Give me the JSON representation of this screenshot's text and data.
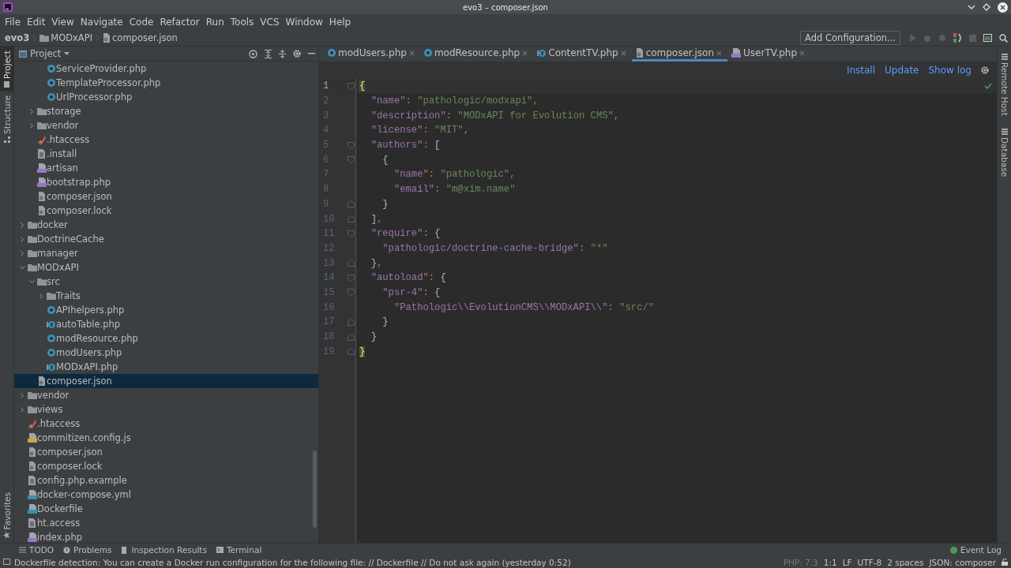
{
  "window": {
    "title": "evo3 – composer.json"
  },
  "menu": [
    "File",
    "Edit",
    "View",
    "Navigate",
    "Code",
    "Refactor",
    "Run",
    "Tools",
    "VCS",
    "Window",
    "Help"
  ],
  "breadcrumb": [
    {
      "label": "evo3",
      "kind": "project"
    },
    {
      "label": "MODxAPI",
      "kind": "folder"
    },
    {
      "label": "composer.json",
      "kind": "composer"
    }
  ],
  "toolbar": {
    "run_configuration": "Add Configuration..."
  },
  "left_stripe": [
    {
      "label": "Project",
      "selected": true
    },
    {
      "label": "Structure",
      "selected": false
    }
  ],
  "favorites": "Favorites",
  "right_stripe": [
    "Remote Host",
    "Database"
  ],
  "project": {
    "title": "Project",
    "tree": [
      {
        "children": [
          {
            "children": [
              {
                "label": "ServiceProvider.php",
                "kind": "class",
                "selected": false
              },
              {
                "label": "TemplateProcessor.php",
                "kind": "class",
                "selected": false
              },
              {
                "label": "UrlProcessor.php",
                "kind": "class",
                "selected": false
              }
            ]
          },
          {
            "label": "storage",
            "kind": "folder",
            "expanded": false,
            "selected": false
          },
          {
            "label": "vendor",
            "kind": "folder",
            "expanded": false,
            "selected": false
          },
          {
            "label": ".htaccess",
            "kind": "htaccess",
            "selected": false
          },
          {
            "label": ".install",
            "kind": "text",
            "selected": false
          },
          {
            "label": "artisan",
            "kind": "php",
            "selected": false
          },
          {
            "label": "bootstrap.php",
            "kind": "php",
            "selected": false
          },
          {
            "label": "composer.json",
            "kind": "composer",
            "selected": false
          },
          {
            "label": "composer.lock",
            "kind": "composer",
            "selected": false
          }
        ]
      },
      {
        "label": "docker",
        "kind": "folder",
        "expanded": false,
        "selected": false
      },
      {
        "label": "DoctrineCache",
        "kind": "folder",
        "expanded": false,
        "selected": false
      },
      {
        "label": "manager",
        "kind": "folder",
        "expanded": false,
        "selected": false
      },
      {
        "label": "MODxAPI",
        "kind": "folder",
        "expanded": true,
        "selected": false,
        "children": [
          {
            "label": "src",
            "kind": "folder",
            "expanded": true,
            "selected": false,
            "children": [
              {
                "label": "Traits",
                "kind": "folder",
                "expanded": false,
                "selected": false
              },
              {
                "label": "APIhelpers.php",
                "kind": "class",
                "selected": false
              },
              {
                "label": "autoTable.php",
                "kind": "interface",
                "selected": false
              },
              {
                "label": "modResource.php",
                "kind": "class",
                "selected": false
              },
              {
                "label": "modUsers.php",
                "kind": "class",
                "selected": false
              },
              {
                "label": "MODxAPI.php",
                "kind": "interface",
                "selected": false
              }
            ]
          },
          {
            "label": "composer.json",
            "kind": "composer",
            "selected": true
          }
        ]
      },
      {
        "label": "vendor",
        "kind": "folder",
        "expanded": false,
        "selected": false
      },
      {
        "label": "views",
        "kind": "folder",
        "expanded": false,
        "selected": false
      },
      {
        "label": ".htaccess",
        "kind": "htaccess",
        "selected": false
      },
      {
        "label": "commitizen.config.js",
        "kind": "js",
        "selected": false
      },
      {
        "label": "composer.json",
        "kind": "composer",
        "selected": false
      },
      {
        "label": "composer.lock",
        "kind": "composer",
        "selected": false
      },
      {
        "label": "config.php.example",
        "kind": "text",
        "selected": false
      },
      {
        "label": "docker-compose.yml",
        "kind": "yml",
        "selected": false
      },
      {
        "label": "Dockerfile",
        "kind": "yml",
        "selected": false
      },
      {
        "label": "ht.access",
        "kind": "text",
        "selected": false
      },
      {
        "label": "index.php",
        "kind": "php",
        "selected": false
      }
    ]
  },
  "tabs": [
    {
      "label": "modUsers.php",
      "kind": "class",
      "selected": false
    },
    {
      "label": "modResource.php",
      "kind": "class",
      "selected": false
    },
    {
      "label": "ContentTV.php",
      "kind": "interface",
      "selected": false
    },
    {
      "label": "composer.json",
      "kind": "composer",
      "selected": true
    },
    {
      "label": "UserTV.php",
      "kind": "php",
      "selected": false
    }
  ],
  "editor_actions": [
    "Install",
    "Update",
    "Show log"
  ],
  "code": [
    {
      "number": "1",
      "current": true,
      "kind": "open",
      "tokens": [
        {
          "kind": "match",
          "text": "{"
        }
      ]
    },
    {
      "number": "2",
      "current": false,
      "kind": "plain",
      "tokens": [
        {
          "kind": "key",
          "text": "  \"name\""
        },
        {
          "kind": "punct",
          "text": ": "
        },
        {
          "kind": "str",
          "text": "\"pathologic/modxapi\""
        },
        {
          "kind": "punct",
          "text": ","
        }
      ]
    },
    {
      "number": "3",
      "current": false,
      "kind": "plain",
      "tokens": [
        {
          "kind": "key",
          "text": "  \"description\""
        },
        {
          "kind": "punct",
          "text": ": "
        },
        {
          "kind": "str",
          "text": "\"MODxAPI for Evolution CMS\""
        },
        {
          "kind": "punct",
          "text": ","
        }
      ]
    },
    {
      "number": "4",
      "current": false,
      "kind": "plain",
      "tokens": [
        {
          "kind": "key",
          "text": "  \"license\""
        },
        {
          "kind": "punct",
          "text": ": "
        },
        {
          "kind": "str",
          "text": "\"MIT\""
        },
        {
          "kind": "punct",
          "text": ","
        }
      ]
    },
    {
      "number": "5",
      "current": false,
      "kind": "open",
      "tokens": [
        {
          "kind": "key",
          "text": "  \"authors\""
        },
        {
          "kind": "punct",
          "text": ": "
        },
        {
          "kind": "brace",
          "text": "["
        }
      ]
    },
    {
      "number": "6",
      "current": false,
      "kind": "open",
      "tokens": [
        {
          "kind": "brace",
          "text": "    {"
        }
      ]
    },
    {
      "number": "7",
      "current": false,
      "kind": "plain",
      "tokens": [
        {
          "kind": "key",
          "text": "      \"name\""
        },
        {
          "kind": "punct",
          "text": ": "
        },
        {
          "kind": "str",
          "text": "\"pathologic\""
        },
        {
          "kind": "punct",
          "text": ","
        }
      ]
    },
    {
      "number": "8",
      "current": false,
      "kind": "plain",
      "tokens": [
        {
          "kind": "key",
          "text": "      \"email\""
        },
        {
          "kind": "punct",
          "text": ": "
        },
        {
          "kind": "str",
          "text": "\"m@xim.name\""
        }
      ]
    },
    {
      "number": "9",
      "current": false,
      "kind": "close",
      "tokens": [
        {
          "kind": "brace",
          "text": "    }"
        }
      ]
    },
    {
      "number": "10",
      "current": false,
      "kind": "close",
      "tokens": [
        {
          "kind": "brace",
          "text": "  ]"
        },
        {
          "kind": "punct",
          "text": ","
        }
      ]
    },
    {
      "number": "11",
      "current": false,
      "kind": "open",
      "tokens": [
        {
          "kind": "key",
          "text": "  \"require\""
        },
        {
          "kind": "punct",
          "text": ": "
        },
        {
          "kind": "brace",
          "text": "{"
        }
      ]
    },
    {
      "number": "12",
      "current": false,
      "kind": "plain",
      "tokens": [
        {
          "kind": "key",
          "text": "    \"pathologic/doctrine-cache-bridge\""
        },
        {
          "kind": "punct",
          "text": ": "
        },
        {
          "kind": "str",
          "text": "\"*\""
        }
      ]
    },
    {
      "number": "13",
      "current": false,
      "kind": "close",
      "tokens": [
        {
          "kind": "brace",
          "text": "  }"
        },
        {
          "kind": "punct",
          "text": ","
        }
      ]
    },
    {
      "number": "14",
      "current": false,
      "kind": "open",
      "tokens": [
        {
          "kind": "key",
          "text": "  \"autoload\""
        },
        {
          "kind": "punct",
          "text": ": "
        },
        {
          "kind": "brace",
          "text": "{"
        }
      ]
    },
    {
      "number": "15",
      "current": false,
      "kind": "open",
      "tokens": [
        {
          "kind": "key",
          "text": "    \"psr-4\""
        },
        {
          "kind": "punct",
          "text": ": "
        },
        {
          "kind": "brace",
          "text": "{"
        }
      ]
    },
    {
      "number": "16",
      "current": false,
      "kind": "plain",
      "tokens": [
        {
          "kind": "key",
          "text": "      \"Pathologic\\\\EvolutionCMS\\\\MODxAPI\\\\\""
        },
        {
          "kind": "punct",
          "text": ": "
        },
        {
          "kind": "str",
          "text": "\"src/\""
        }
      ]
    },
    {
      "number": "17",
      "current": false,
      "kind": "close",
      "tokens": [
        {
          "kind": "brace",
          "text": "    }"
        }
      ]
    },
    {
      "number": "18",
      "current": false,
      "kind": "close",
      "tokens": [
        {
          "kind": "brace",
          "text": "  }"
        }
      ]
    },
    {
      "number": "19",
      "current": false,
      "kind": "close",
      "tokens": [
        {
          "kind": "match",
          "text": "}"
        }
      ]
    }
  ],
  "tool_tabs": [
    {
      "label": "TODO",
      "kind": "list"
    },
    {
      "label": "Problems",
      "kind": "info"
    },
    {
      "label": "Inspection Results",
      "kind": "doc"
    },
    {
      "label": "Terminal",
      "kind": "terminal"
    }
  ],
  "event_log": "Event Log",
  "status_bar": {
    "message": "Dockerfile detection: You can create a Docker run configuration for the following file: // Dockerfile // Do not ask again (yesterday 0:52)",
    "items": [
      {
        "text": "PHP: 7.3",
        "disabled": true
      },
      {
        "text": "1:1",
        "disabled": false
      },
      {
        "text": "LF",
        "disabled": false
      },
      {
        "text": "UTF-8",
        "disabled": false
      },
      {
        "text": "2 spaces",
        "disabled": false
      },
      {
        "text": "JSON: composer",
        "disabled": false
      }
    ]
  }
}
